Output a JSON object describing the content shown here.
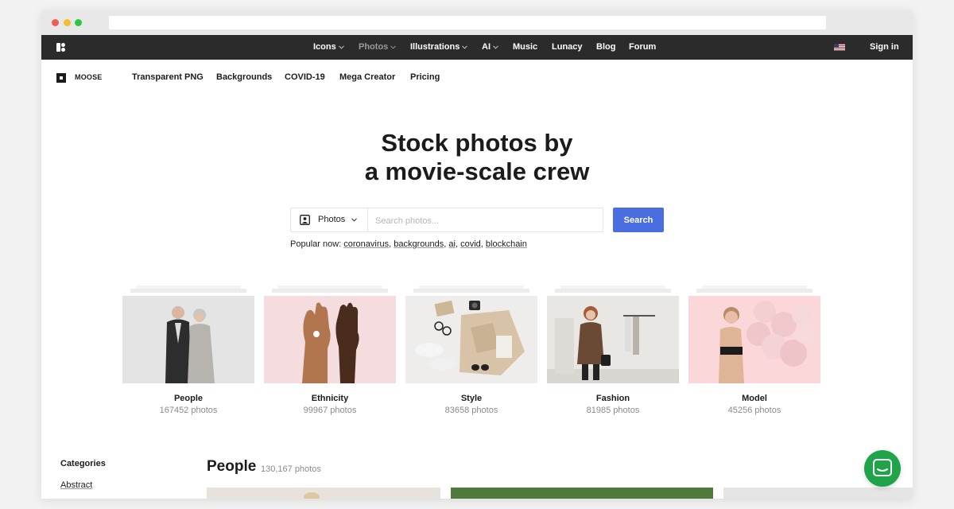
{
  "top_nav": {
    "items": [
      {
        "label": "Icons",
        "dropdown": true
      },
      {
        "label": "Photos",
        "dropdown": true
      },
      {
        "label": "Illustrations",
        "dropdown": true
      },
      {
        "label": "AI",
        "dropdown": true
      },
      {
        "label": "Music",
        "dropdown": false
      },
      {
        "label": "Lunacy",
        "dropdown": false
      },
      {
        "label": "Blog",
        "dropdown": false
      },
      {
        "label": "Forum",
        "dropdown": false
      }
    ],
    "active": "Photos",
    "flag_icon": "us-flag-icon",
    "sign_in": "Sign in"
  },
  "sub_nav": {
    "brand": "MOOSE",
    "items": [
      "Transparent PNG",
      "Backgrounds",
      "COVID-19",
      "Mega Creator",
      "Pricing"
    ]
  },
  "hero": {
    "title_line1": "Stock photos by",
    "title_line2": "a movie-scale crew"
  },
  "search": {
    "type_label": "Photos",
    "placeholder": "Search photos...",
    "button": "Search",
    "popular_label": "Popular now:",
    "popular_terms": [
      "coronavirus",
      "backgrounds",
      "ai",
      "covid",
      "blockchain"
    ]
  },
  "categories": [
    {
      "name": "People",
      "count": "167452 photos"
    },
    {
      "name": "Ethnicity",
      "count": "99967 photos"
    },
    {
      "name": "Style",
      "count": "83658 photos"
    },
    {
      "name": "Fashion",
      "count": "81985 photos"
    },
    {
      "name": "Model",
      "count": "45256 photos"
    }
  ],
  "sidebar": {
    "title": "Categories",
    "first_item": "Abstract"
  },
  "people_section": {
    "title": "People",
    "count": "130,167 photos"
  },
  "colors": {
    "nav_bg": "#2b2b2b",
    "search_button": "#4a6ee0",
    "chat_button": "#1fa44a"
  }
}
